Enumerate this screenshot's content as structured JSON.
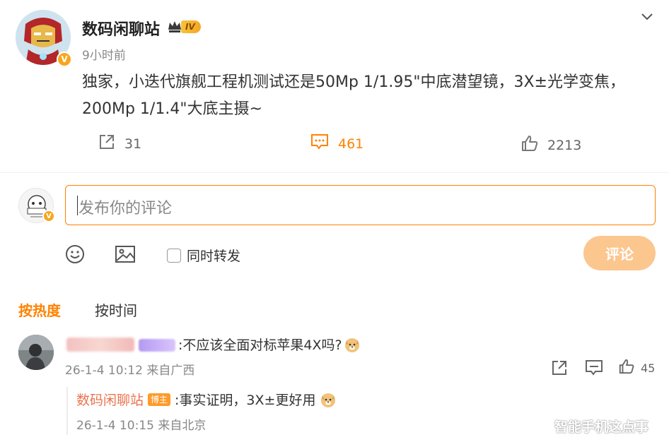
{
  "post": {
    "author": "数码闲聊站",
    "level_badge": "IV",
    "verified_mark": "V",
    "time": "9小时前",
    "text_line1": "独家，小迭代旗舰工程机测试还是50Mp 1/1.95\"中底潜望镜，3X±光学变焦，",
    "text_line2": "200Mp 1/1.4\"大底主摄~",
    "shares": "31",
    "comments": "461",
    "likes": "2213"
  },
  "composer": {
    "placeholder": "发布你的评论",
    "repost_label": "同时转发",
    "submit_label": "评论"
  },
  "sort_tabs": {
    "hot": "按热度",
    "time": "按时间"
  },
  "comments": [
    {
      "text": ":不应该全面对标苹果4X吗?",
      "meta": "26-1-4 10:12 来自广西",
      "likes": "45",
      "reply": {
        "user": "数码闲聊站",
        "badge": "博主",
        "text": ":事实证明，3X±更好用",
        "meta": "26-1-4 10:15 来自北京"
      }
    }
  ],
  "watermark": "智能手机这点事",
  "colors": {
    "accent": "#ff8200",
    "submit_disabled": "#fcc68f",
    "reply_user": "#eb7350",
    "muted_text": "#888888"
  },
  "icons": [
    "collapse-chevron-icon",
    "crown-icon",
    "share-icon",
    "comment-icon",
    "like-icon",
    "emoji-icon",
    "image-icon",
    "doge-emoji-icon"
  ]
}
